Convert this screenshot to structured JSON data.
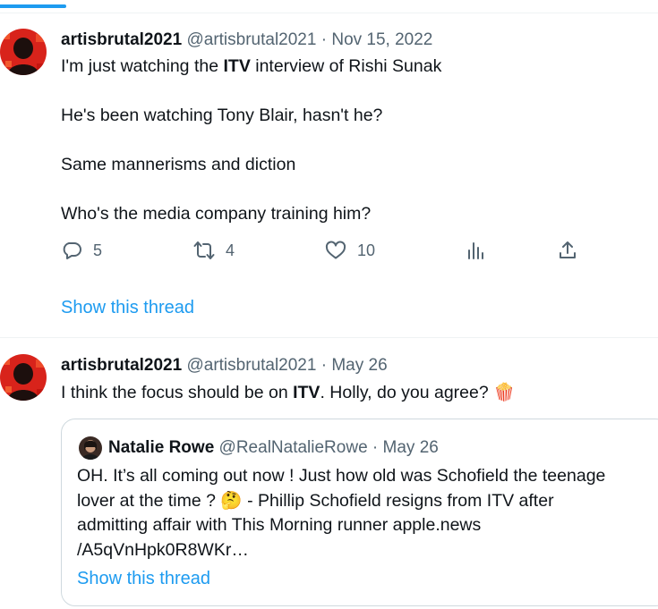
{
  "colors": {
    "accent": "#1d9bf0",
    "secondary_text": "#536471",
    "border": "#cfd9de"
  },
  "progress": {
    "fraction": 0.1
  },
  "tweets": [
    {
      "name": "artisbrutal2021",
      "handle": "@artisbrutal2021",
      "separator": "·",
      "date": "Nov 15, 2022",
      "lines": [
        {
          "before": "I'm just watching the ",
          "bold": "ITV",
          "after": " interview of Rishi Sunak"
        },
        {
          "text": "He's been watching Tony Blair, hasn't he?"
        },
        {
          "text": "Same mannerisms and diction"
        },
        {
          "text": "Who's the media company training him?"
        }
      ],
      "replies": "5",
      "retweets": "4",
      "likes": "10",
      "show_thread": "Show this thread"
    },
    {
      "name": "artisbrutal2021",
      "handle": "@artisbrutal2021",
      "separator": "·",
      "date": "May 26",
      "line": {
        "before": "I think the focus should be on ",
        "bold": "ITV",
        "after": ". Holly, do you agree? ",
        "emoji": "🍿"
      },
      "quote": {
        "name": "Natalie Rowe",
        "handle": "@RealNatalieRowe",
        "separator": "·",
        "date": "May 26",
        "lines": [
          "OH. It’s all coming out now ! Just how old was Schofield the teenage",
          "lover at the time ? 🤔 - Phillip Schofield resigns from ITV after",
          "admitting affair with This Morning runner  apple.news",
          "/A5qVnHpk0R8WKr…"
        ],
        "show_thread": "Show this thread"
      }
    }
  ],
  "icons": [
    "reply-icon",
    "retweet-icon",
    "like-icon",
    "analytics-icon",
    "share-icon"
  ]
}
